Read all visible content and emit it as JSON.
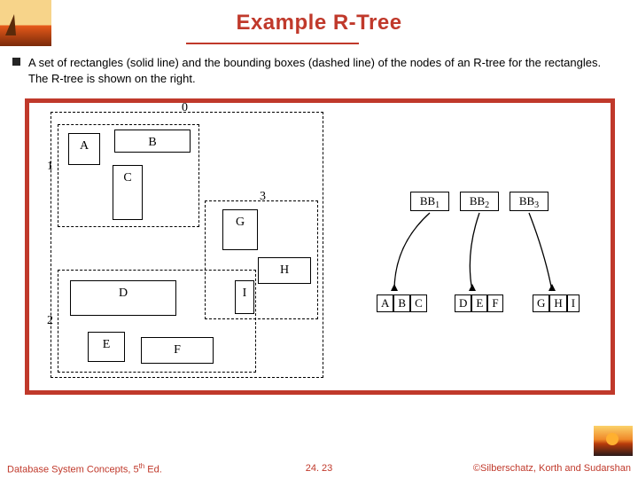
{
  "title": "Example R-Tree",
  "body_text": "A set of rectangles (solid line) and the bounding boxes (dashed line) of the nodes of an R-tree for the rectangles. The R-tree is shown on the right.",
  "rects": {
    "A": "A",
    "B": "B",
    "C": "C",
    "D": "D",
    "E": "E",
    "F": "F",
    "G": "G",
    "H": "H",
    "I": "I"
  },
  "bbox_labels": {
    "b0": "0",
    "b1": "1",
    "b2": "2",
    "b3": "3"
  },
  "tree_root": {
    "bb1": "BB",
    "bb2": "BB",
    "bb3": "BB",
    "s1": "1",
    "s2": "2",
    "s3": "3"
  },
  "tree_leaves": {
    "g1": {
      "a": "A",
      "b": "B",
      "c": "C"
    },
    "g2": {
      "d": "D",
      "e": "E",
      "f": "F"
    },
    "g3": {
      "g": "G",
      "h": "H",
      "i": "I"
    }
  },
  "slide_number": "23",
  "footer_left_prefix": "Database System Concepts, 5",
  "footer_left_suffix": " Ed.",
  "footer_left_sup": "th",
  "footer_center": "24. 23",
  "footer_right": "©Silberschatz, Korth and Sudarshan"
}
